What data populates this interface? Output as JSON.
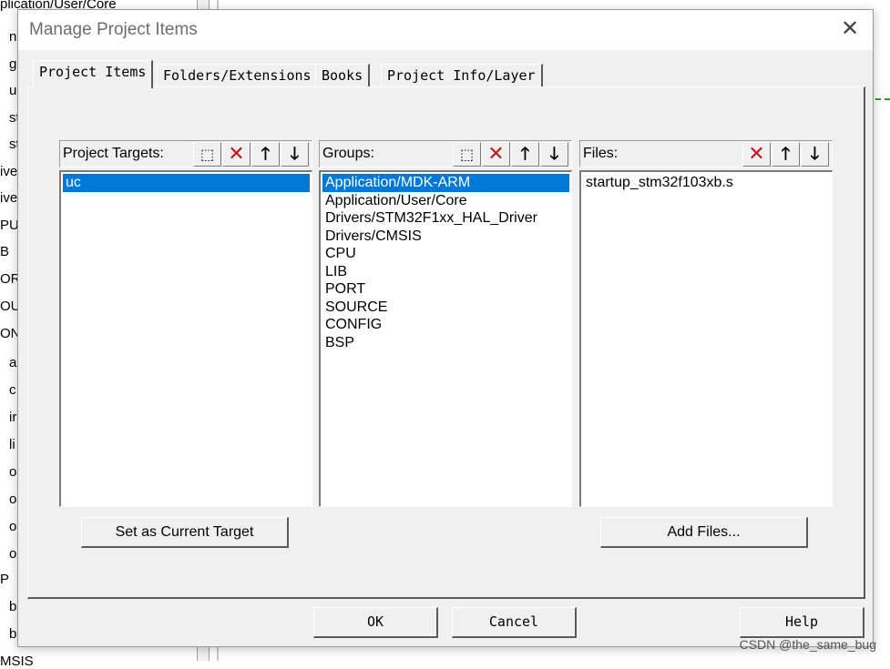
{
  "background": {
    "tree_rows": [
      "plication/User/Core",
      "n",
      "g",
      "u",
      "st",
      "st",
      "ive",
      "ive",
      "PU",
      "B",
      "ORT",
      "OUF",
      "ON",
      "a",
      "c",
      "ir",
      "li",
      "o",
      "o",
      "o",
      "o",
      "P",
      "b",
      "b",
      "MSIS"
    ]
  },
  "dialog": {
    "title": "Manage Project Items",
    "close_icon": "close-icon",
    "tabs": [
      {
        "label": "Project Items",
        "active": true
      },
      {
        "label": "Folders/Extensions",
        "active": false
      },
      {
        "label": "Books",
        "active": false
      },
      {
        "label": "Project Info/Layer",
        "active": false
      }
    ],
    "targets": {
      "label": "Project Targets:",
      "items": [
        "uc"
      ],
      "selected_index": 0,
      "button_label": "Set as Current Target"
    },
    "groups": {
      "label": "Groups:",
      "items": [
        "Application/MDK-ARM",
        "Application/User/Core",
        "Drivers/STM32F1xx_HAL_Driver",
        "Drivers/CMSIS",
        "CPU",
        "LIB",
        "PORT",
        "SOURCE",
        "CONFIG",
        "BSP"
      ],
      "selected_index": 0
    },
    "files": {
      "label": "Files:",
      "items": [
        "startup_stm32f103xb.s"
      ],
      "button_label": "Add Files..."
    },
    "toolbar_icons": {
      "new": "new-item-icon",
      "delete": "delete-icon",
      "up": "move-up-icon",
      "down": "move-down-icon"
    },
    "ok_label": "OK",
    "cancel_label": "Cancel",
    "help_label": "Help"
  },
  "watermark": "CSDN @the_same_bug",
  "colors": {
    "selection": "#0078d7",
    "delete": "#c0181f",
    "dialog_bg": "#f0f0f0"
  }
}
